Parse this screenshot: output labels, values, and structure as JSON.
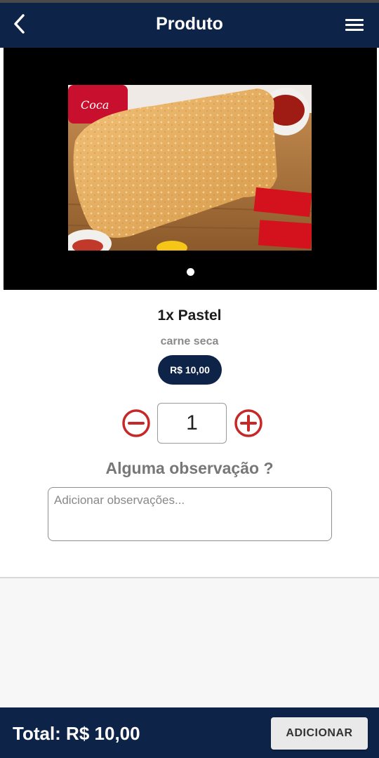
{
  "header": {
    "title": "Produto",
    "back_icon": "chevron-left-icon",
    "menu_icon": "hamburger-menu-icon"
  },
  "carousel": {
    "image_alt": "Pastel",
    "page_count": 1,
    "active_page": 1
  },
  "product": {
    "name": "1x Pastel",
    "description": "carne seca",
    "price": "R$ 10,00"
  },
  "quantity": {
    "value": "1",
    "minus_icon": "minus-circle-icon",
    "plus_icon": "plus-circle-icon"
  },
  "observation": {
    "title": "Alguma observação ?",
    "placeholder": "Adicionar observações...",
    "value": ""
  },
  "footer": {
    "total": "Total: R$ 10,00",
    "add_label": "ADICIONAR"
  },
  "colors": {
    "primary": "#0d2347",
    "qty_icon": "#c62828",
    "background": "#f7f7f7"
  }
}
